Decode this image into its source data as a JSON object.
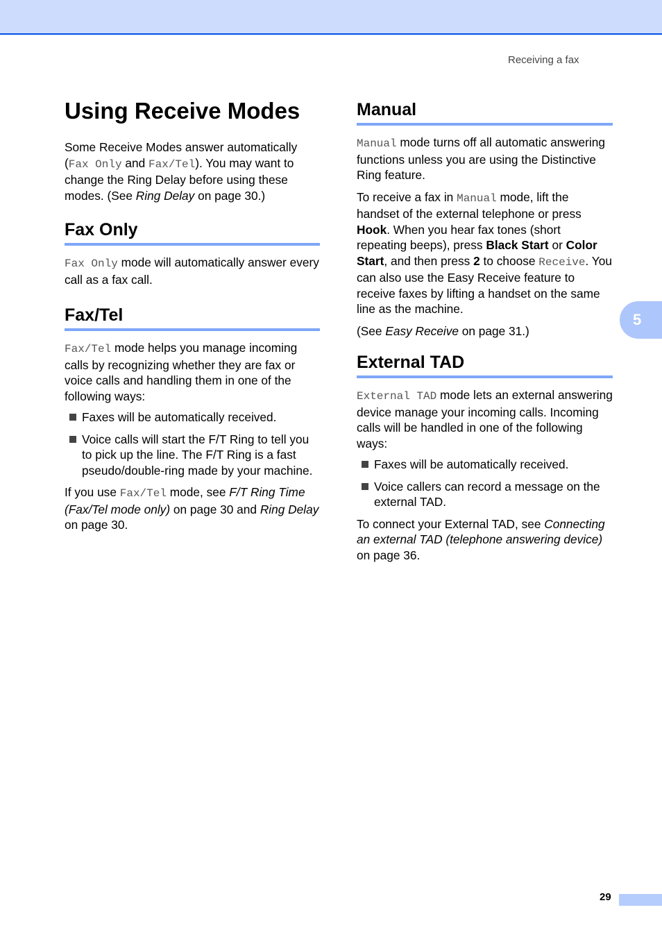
{
  "header": {
    "running_title": "Receiving a fax"
  },
  "page_title": "Using Receive Modes",
  "intro": {
    "t1": "Some Receive Modes answer automatically (",
    "m1": "Fax Only",
    "t2": " and ",
    "m2": "Fax/Tel",
    "t3": "). You may want to change the Ring Delay before using these modes. (See ",
    "ref": "Ring Delay",
    "t4": " on page 30.)"
  },
  "sections": {
    "fax_only": {
      "heading": "Fax Only",
      "mono": "Fax Only",
      "text": " mode will automatically answer every call as a fax call."
    },
    "fax_tel": {
      "heading": "Fax/Tel",
      "mono": "Fax/Tel",
      "text": " mode helps you manage incoming calls by recognizing whether they are fax or voice calls and handling them in one of the following ways:",
      "bullets": [
        "Faxes will be automatically received.",
        "Voice calls will start the F/T Ring to tell you to pick up the line. The F/T Ring is a fast pseudo/double-ring made by your machine."
      ],
      "note": {
        "t1": "If you use ",
        "m1": "Fax/Tel",
        "t2": " mode, see ",
        "ref1": "F/T Ring Time (Fax/Tel mode only)",
        "t3": " on page 30 and ",
        "ref2": "Ring Delay",
        "t4": " on page 30."
      }
    },
    "manual": {
      "heading": "Manual",
      "p1": {
        "mono": "Manual",
        "text": " mode turns off all automatic answering functions unless you are using the Distinctive Ring feature."
      },
      "p2": {
        "t1": "To receive a fax in ",
        "m1": "Manual",
        "t2": " mode, lift the handset of the external telephone or press ",
        "b1": "Hook",
        "t3": ". When you hear fax tones (short repeating beeps), press ",
        "b2": "Black Start",
        "t4": " or ",
        "b3": "Color Start",
        "t5": ", and then press ",
        "b4": "2",
        "t6": " to choose ",
        "m2": "Receive",
        "t7": ". You can also use the Easy Receive feature to receive faxes by lifting a handset on the same line as the machine."
      },
      "p3": {
        "t1": "(See ",
        "ref": "Easy Receive",
        "t2": " on page 31.)"
      }
    },
    "external_tad": {
      "heading": "External TAD",
      "mono": "External TAD",
      "text": " mode lets an external answering device manage your incoming calls. Incoming calls will be handled in one of the following ways:",
      "bullets": [
        "Faxes will be automatically received.",
        "Voice callers can record a message on the external TAD."
      ],
      "note": {
        "t1": "To connect your External TAD, see ",
        "ref": "Connecting an external TAD (telephone answering device)",
        "t2": " on page 36."
      }
    }
  },
  "chapter_tab": "5",
  "page_number": "29",
  "colors": {
    "header_band": "#cddcfd",
    "header_rule": "#0050e6",
    "heading_rule": "#7fa7f7",
    "chapter_tab": "#adc6fb"
  }
}
